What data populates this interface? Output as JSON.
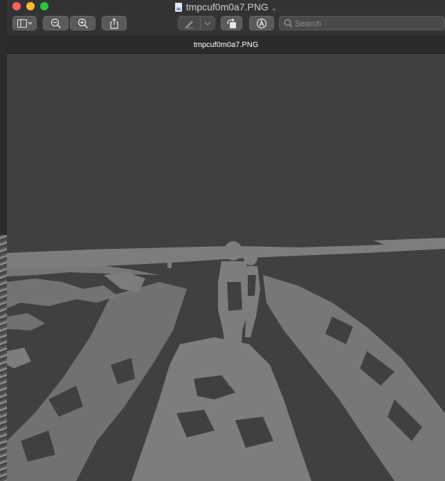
{
  "window": {
    "title": "tmpcuf0m0a7.PNG",
    "tab_title": "tmpcuf0m0a7.PNG"
  },
  "toolbar": {
    "search": {
      "placeholder": "Search",
      "value": ""
    }
  },
  "icons": {
    "sidebar": "sidebar-toggle-icon",
    "zoom_out": "zoom-out-icon",
    "zoom_in": "zoom-in-icon",
    "share": "share-icon",
    "markup": "pen-icon",
    "rotate": "rotate-icon",
    "annotate": "annotate-icon",
    "search": "search-icon"
  },
  "colors": {
    "close": "#ff5f57",
    "minimize": "#febc2e",
    "maximize": "#28c840",
    "image_dark": "#404040",
    "image_light": "#7d7d7d"
  }
}
